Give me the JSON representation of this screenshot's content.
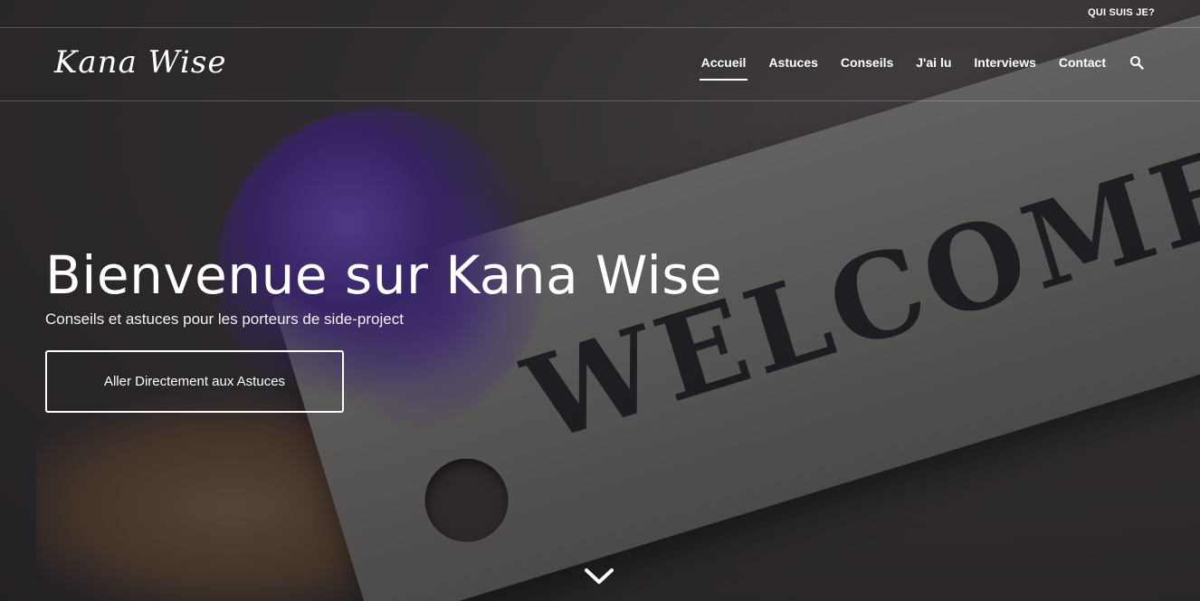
{
  "topbar": {
    "link_label": "QUI SUIS JE?"
  },
  "header": {
    "logo_text": "Kana Wise",
    "nav": [
      {
        "label": "Accueil",
        "active": true
      },
      {
        "label": "Astuces"
      },
      {
        "label": "Conseils"
      },
      {
        "label": "J'ai lu"
      },
      {
        "label": "Interviews"
      },
      {
        "label": "Contact"
      }
    ],
    "search_icon": "search-icon"
  },
  "hero": {
    "title": "Bienvenue sur Kana Wise",
    "subtitle": "Conseils et astuces pour les porteurs de side-project",
    "cta_label": "Aller Directement aux Astuces",
    "background_sign_text": "WELCOME",
    "scroll_icon": "chevron-down-icon"
  }
}
